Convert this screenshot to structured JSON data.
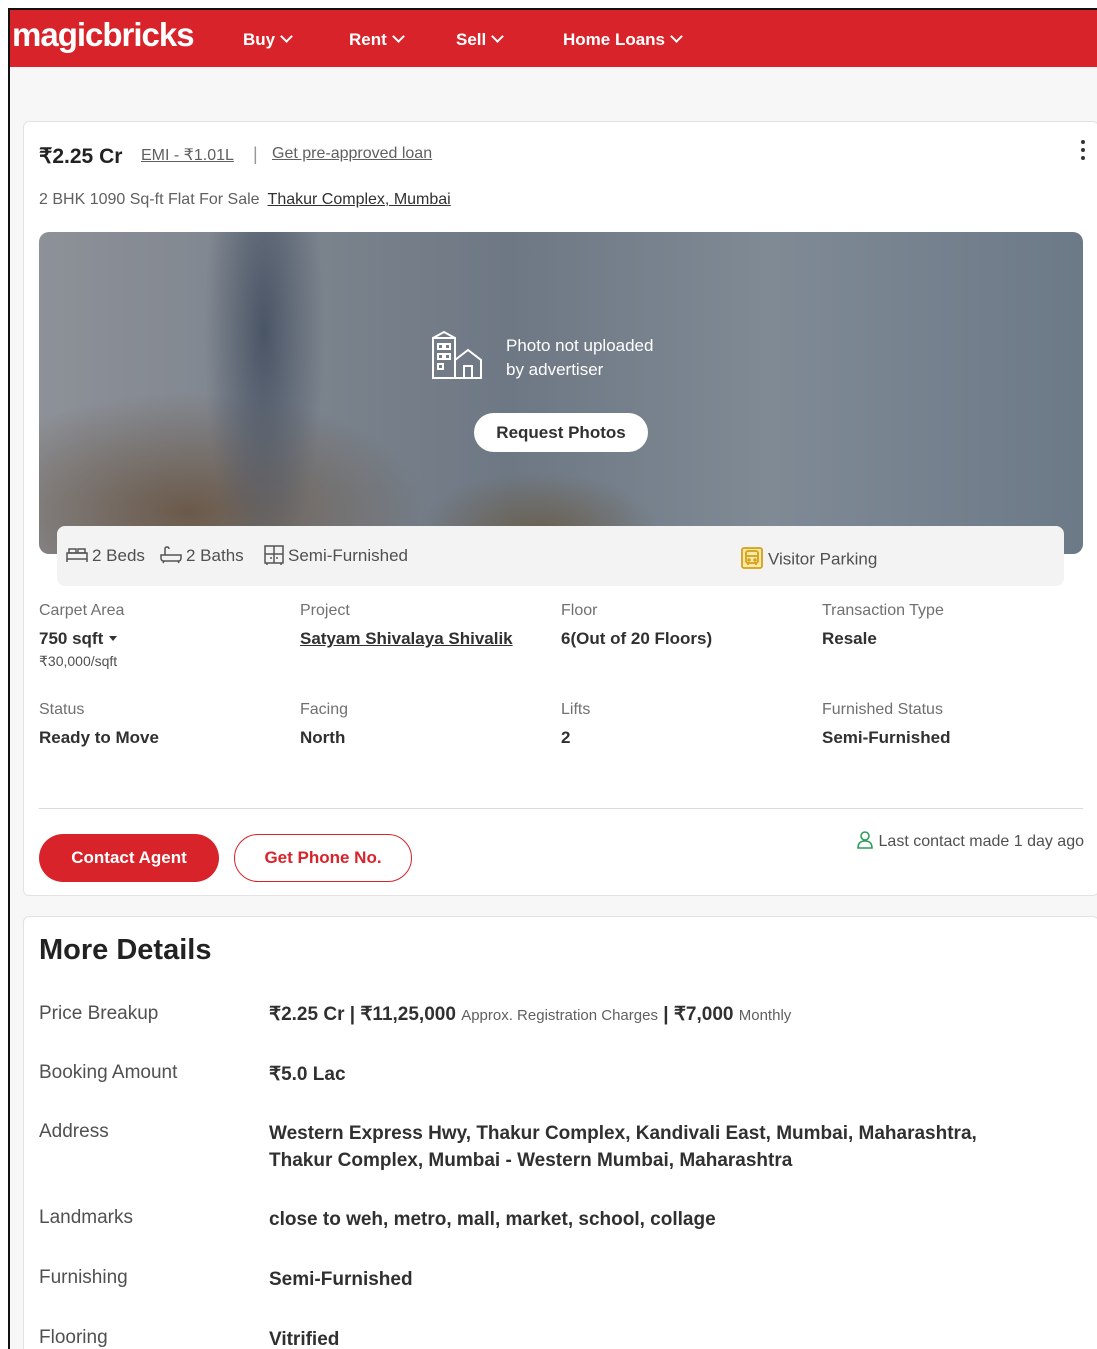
{
  "header": {
    "logo": "magicbricks",
    "nav": [
      "Buy",
      "Rent",
      "Sell",
      "Home Loans"
    ]
  },
  "listing": {
    "price": "₹2.25 Cr",
    "emi": "EMI - ₹1.01L",
    "separator": "|",
    "loan_link": "Get pre-approved loan",
    "subtitle": "2 BHK 1090 Sq-ft Flat For Sale",
    "location_link": "Thakur Complex, Mumbai",
    "photo": {
      "no_photo_line1": "Photo not uploaded",
      "no_photo_line2": "by advertiser",
      "request_button": "Request Photos"
    },
    "amenities": {
      "beds": "2 Beds",
      "baths": "2 Baths",
      "furnishing": "Semi-Furnished",
      "parking": "Visitor Parking"
    },
    "details": {
      "carpet_area_label": "Carpet Area",
      "carpet_area_value": "750 sqft",
      "carpet_area_rate": "₹30,000/sqft",
      "project_label": "Project",
      "project_value": "Satyam Shivalaya Shivalik",
      "floor_label": "Floor",
      "floor_value": "6(Out of 20 Floors)",
      "transaction_label": "Transaction Type",
      "transaction_value": "Resale",
      "status_label": "Status",
      "status_value": "Ready to Move",
      "facing_label": "Facing",
      "facing_value": "North",
      "lifts_label": "Lifts",
      "lifts_value": "2",
      "furnished_label": "Furnished Status",
      "furnished_value": "Semi-Furnished"
    },
    "contact_button": "Contact Agent",
    "phone_button": "Get Phone No.",
    "last_contact": "Last contact made 1 day ago"
  },
  "more_details": {
    "title": "More Details",
    "price_breakup_label": "Price Breakup",
    "price_breakup_value1": "₹2.25 Cr | ₹11,25,000",
    "price_breakup_note1": "Approx. Registration Charges",
    "price_breakup_value2": "| ₹7,000",
    "price_breakup_note2": "Monthly",
    "booking_label": "Booking Amount",
    "booking_value": "₹5.0 Lac",
    "address_label": "Address",
    "address_line1": "Western Express Hwy, Thakur Complex, Kandivali East, Mumbai, Maharashtra,",
    "address_line2": "Thakur Complex, Mumbai - Western Mumbai, Maharashtra",
    "landmarks_label": "Landmarks",
    "landmarks_value": "close to weh, metro, mall, market, school, collage",
    "furnishing_label": "Furnishing",
    "furnishing_value": "Semi-Furnished",
    "flooring_label": "Flooring",
    "flooring_value": "Vitrified"
  },
  "colors": {
    "brand_red": "#d8232a",
    "text_dark": "#303030"
  }
}
